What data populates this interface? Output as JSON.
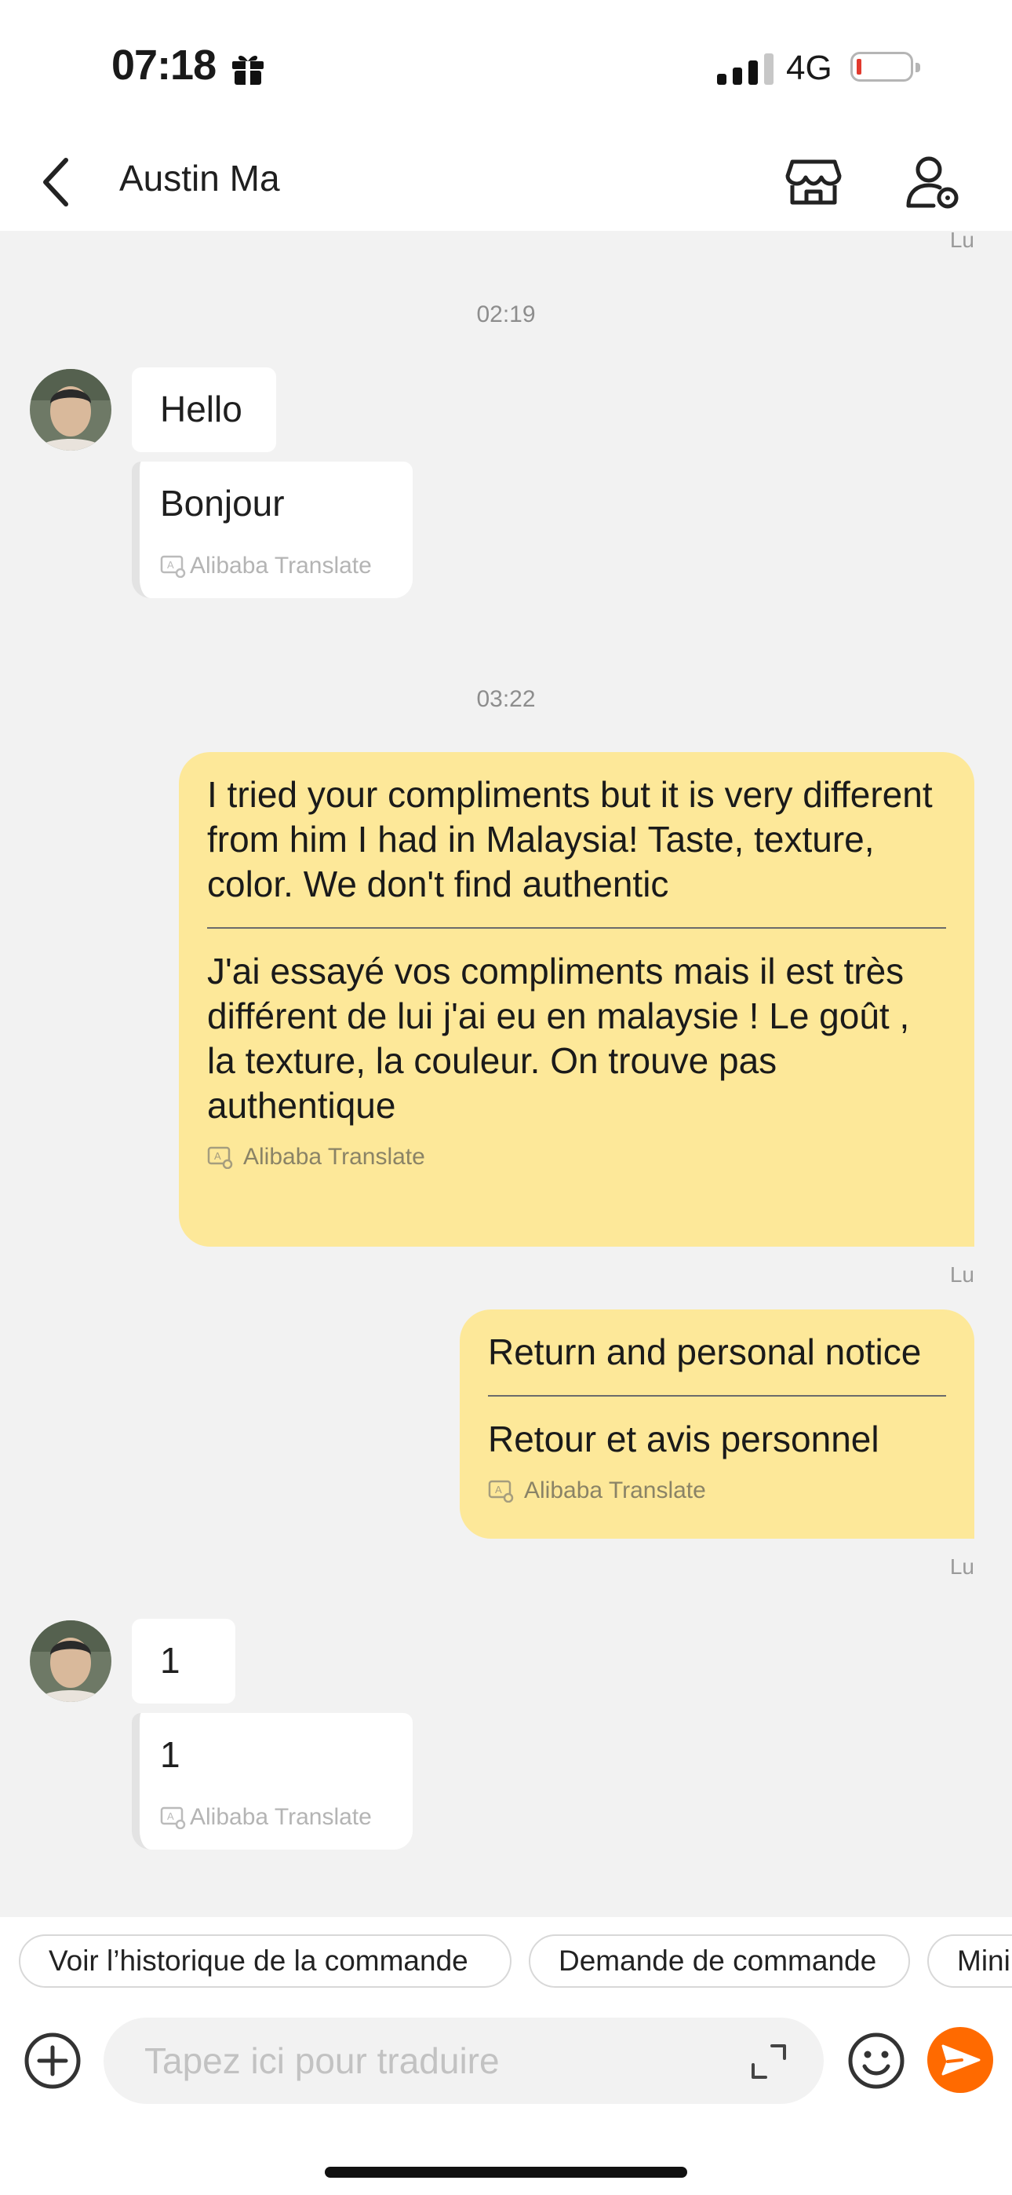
{
  "status": {
    "time": "07:18",
    "network": "4G"
  },
  "header": {
    "name": "Austin Ma"
  },
  "chat": {
    "top_read": "Lu",
    "ts1": "02:19",
    "msg1": {
      "text": "Hello",
      "translation": "Bonjour",
      "translate_label": "Alibaba Translate"
    },
    "ts2": "03:22",
    "out1": {
      "text": "I tried your compliments but it is very different from him I had in Malaysia! Taste, texture, color. We don't find authentic",
      "translation": "J'ai essayé vos compliments mais il est très différent de lui j'ai eu en malaysie ! Le goût , la texture, la couleur. On trouve pas authentique",
      "translate_label": "Alibaba Translate",
      "read": "Lu"
    },
    "out2": {
      "text": "Return and personal notice",
      "translation": "Retour et avis personnel",
      "translate_label": "Alibaba Translate",
      "read": "Lu"
    },
    "msg2": {
      "text": "1",
      "translation": "1",
      "translate_label": "Alibaba Translate"
    }
  },
  "quick_replies": [
    "Voir l’historique de la commande",
    "Demande de commande",
    "Mini"
  ],
  "composer": {
    "placeholder": "Tapez ici pour traduire"
  },
  "colors": {
    "accent": "#ff6a00",
    "bubble_out": "#fde899",
    "background": "#f2f2f2"
  }
}
